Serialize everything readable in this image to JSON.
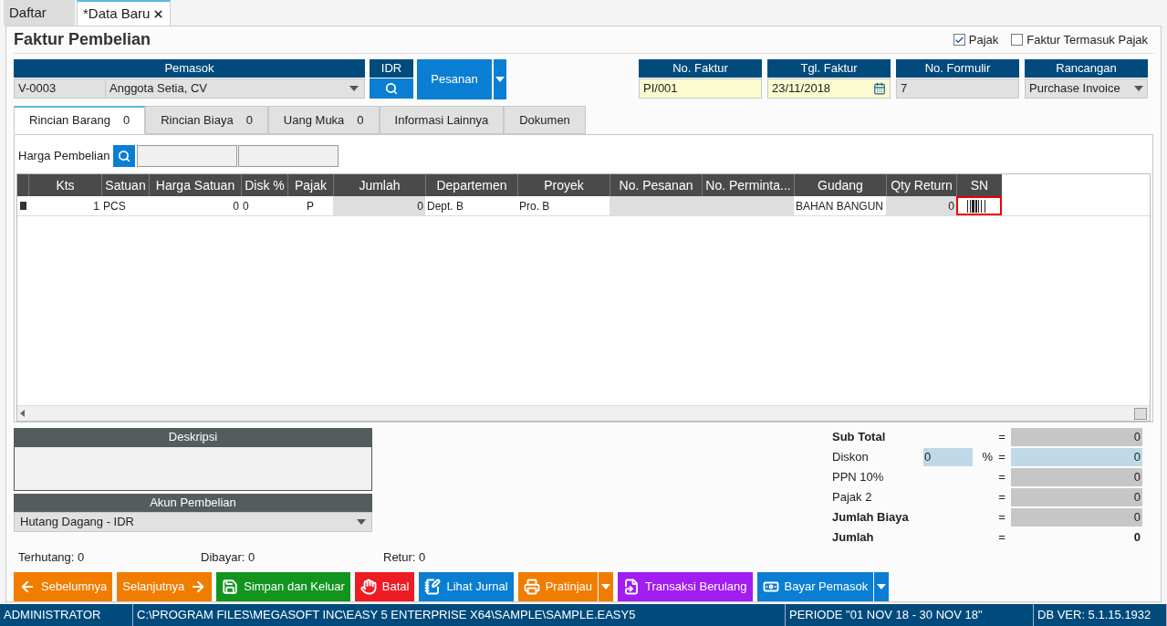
{
  "doc_tabs": [
    {
      "label": "Daftar",
      "selected": false,
      "closable": false
    },
    {
      "label": "*Data Baru",
      "selected": true,
      "closable": true
    }
  ],
  "title": "Faktur Pembelian",
  "options": [
    {
      "label": "Pajak",
      "checked": true
    },
    {
      "label": "Faktur Termasuk Pajak",
      "checked": false
    }
  ],
  "supplier": {
    "header": "Pemasok",
    "code": "V-0003",
    "name": "Anggota Setia, CV"
  },
  "currency": {
    "header": "IDR"
  },
  "order_button": {
    "label": "Pesanan"
  },
  "header_fields": [
    {
      "header": "No. Faktur",
      "value": "PI/001",
      "kind": "input"
    },
    {
      "header": "Tgl. Faktur",
      "value": "23/11/2018",
      "kind": "date"
    },
    {
      "header": "No. Formulir",
      "value": "7",
      "kind": "readonly"
    },
    {
      "header": "Rancangan",
      "value": "Purchase Invoice",
      "kind": "select"
    }
  ],
  "tabs": [
    {
      "label": "Rincian Barang",
      "count": "0",
      "selected": true
    },
    {
      "label": "Rincian Biaya",
      "count": "0",
      "selected": false
    },
    {
      "label": "Uang Muka",
      "count": "0",
      "selected": false
    },
    {
      "label": "Informasi Lainnya",
      "selected": false
    },
    {
      "label": "Dokumen",
      "selected": false
    }
  ],
  "price_lookup": {
    "label": "Harga Pembelian"
  },
  "table": {
    "columns": [
      {
        "label": "Kts"
      },
      {
        "label": "Satuan"
      },
      {
        "label": "Harga Satuan"
      },
      {
        "label": "Disk %"
      },
      {
        "label": "Pajak"
      },
      {
        "label": "Jumlah"
      },
      {
        "label": "Departemen"
      },
      {
        "label": "Proyek"
      },
      {
        "label": "No. Pesanan"
      },
      {
        "label": "No. Perminta..."
      },
      {
        "label": "Gudang"
      },
      {
        "label": "Qty Return"
      },
      {
        "label": "SN"
      }
    ],
    "rows": [
      {
        "cells": [
          {
            "kind": "text",
            "text": "1",
            "shaded": false
          },
          {
            "kind": "text",
            "text": "PCS",
            "shaded": false
          },
          {
            "kind": "text",
            "text": "0",
            "shaded": false
          },
          {
            "kind": "text",
            "text": "0",
            "shaded": false
          },
          {
            "kind": "text",
            "text": "P",
            "shaded": false
          },
          {
            "kind": "text",
            "text": "0",
            "shaded": true
          },
          {
            "kind": "text",
            "text": "Dept. B",
            "shaded": false
          },
          {
            "kind": "text",
            "text": "Pro. B",
            "shaded": false
          },
          {
            "kind": "text",
            "text": "",
            "shaded": true
          },
          {
            "kind": "text",
            "text": "",
            "shaded": true
          },
          {
            "kind": "text",
            "text": "BAHAN BANGUN",
            "shaded": false
          },
          {
            "kind": "text",
            "text": "0",
            "shaded": true
          },
          {
            "kind": "barcode",
            "highlighted": true,
            "shaded": false
          }
        ]
      }
    ]
  },
  "description": {
    "header": "Deskripsi"
  },
  "purchase_account": {
    "header": "Akun Pembelian",
    "value": "Hutang Dagang - IDR"
  },
  "summary": [
    "Terhutang: 0",
    "Dibayar: 0",
    "Retur: 0"
  ],
  "totals": [
    {
      "label": "Sub Total",
      "bold": true,
      "kind": "grey",
      "equals": "=",
      "value": "0"
    },
    {
      "label": "Diskon",
      "bold": false,
      "kind": "discount",
      "percent": "0",
      "percent_sign": "%",
      "equals": "=",
      "value": "0"
    },
    {
      "label": "PPN 10%",
      "bold": false,
      "kind": "grey",
      "equals": "=",
      "value": "0"
    },
    {
      "label": "Pajak 2",
      "bold": false,
      "kind": "grey",
      "equals": "=",
      "value": "0"
    },
    {
      "label": "Jumlah Biaya",
      "bold": true,
      "kind": "grey",
      "equals": "=",
      "value": "0"
    },
    {
      "label": "Jumlah",
      "bold": true,
      "kind": "plain",
      "equals": "=",
      "value": "0"
    }
  ],
  "buttons": [
    {
      "label": "Sebelumnya",
      "kind": "previous",
      "color": "#f07d00",
      "dropdown": false
    },
    {
      "label": "Selanjutnya",
      "kind": "next",
      "color": "#f07d00",
      "dropdown": false
    },
    {
      "label": "Simpan dan Keluar",
      "kind": "save",
      "color": "#12941f",
      "dropdown": false
    },
    {
      "label": "Batal",
      "kind": "cancel",
      "color": "#ed1c24",
      "dropdown": false
    },
    {
      "label": "Lihat Jurnal",
      "kind": "journal",
      "color": "#0a7ed2",
      "dropdown": false
    },
    {
      "label": "Pratinjau",
      "kind": "preview",
      "color": "#f07d00",
      "dropdown": true
    },
    {
      "label": "Transaksi Berulang",
      "kind": "recurring",
      "color": "#a11df0",
      "dropdown": false
    },
    {
      "label": "Bayar Pemasok",
      "kind": "pay",
      "color": "#0a7ed2",
      "dropdown": true
    }
  ],
  "status_bar": [
    "ADMINISTRATOR",
    "C:\\PROGRAM FILES\\MEGASOFT INC\\EASY 5 ENTERPRISE X64\\SAMPLE\\SAMPLE.EASY5",
    "PERIODE \"01 NOV 18 - 30 NOV 18\"",
    "DB VER: 5.1.15.1932"
  ]
}
